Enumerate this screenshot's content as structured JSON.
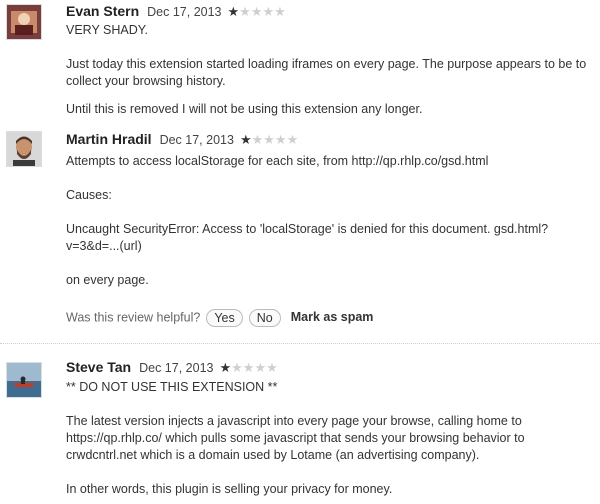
{
  "reviews": [
    {
      "author": "Evan Stern",
      "date": "Dec 17, 2013",
      "rating": 1,
      "paragraphs": [
        "VERY SHADY.",
        "Just today this extension started loading iframes on every page. The purpose appears to be to collect your browsing history.",
        "Until this is removed I will not be using this extension any longer."
      ]
    },
    {
      "author": "Martin Hradil",
      "date": "Dec 17, 2013",
      "rating": 1,
      "paragraphs": [
        "Attempts to access localStorage for each site, from http://qp.rhlp.co/gsd.html",
        "Causes:",
        "Uncaught SecurityError: Access to 'localStorage' is denied for this document. gsd.html?v=3&d=...(url)",
        "on every page."
      ],
      "helpful": {
        "prompt": "Was this review helpful?",
        "yes": "Yes",
        "no": "No",
        "spam": "Mark as spam"
      }
    },
    {
      "author": "Steve Tan",
      "date": "Dec 17, 2013",
      "rating": 1,
      "paragraphs": [
        "** DO NOT USE THIS EXTENSION **",
        "The latest version injects a javascript into every page your browse, calling home to https://qp.rhlp.co/ which pulls some javascript that sends your browsing behavior to crwdcntrl.net which is a domain used by Lotame (an advertising company).",
        "In other words, this plugin is selling your privacy for money."
      ]
    }
  ],
  "star_symbol": "★",
  "max_stars": 5
}
